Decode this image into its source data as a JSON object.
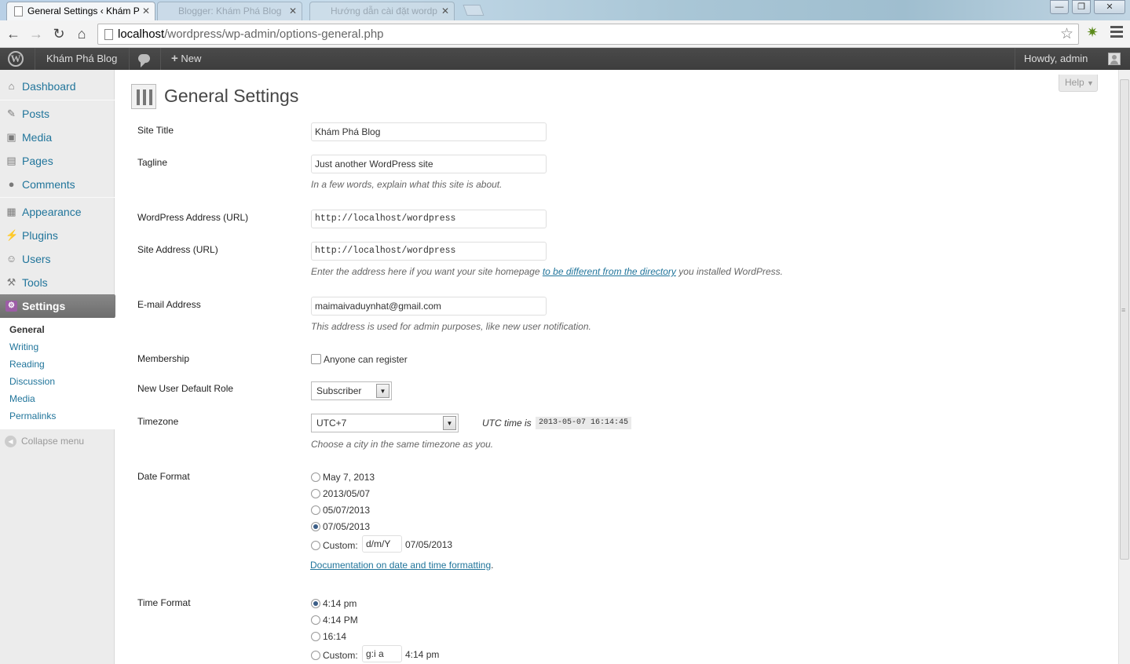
{
  "browser": {
    "active_tab_title": "General Settings ‹ Khám P",
    "tab2_title": "Blogger: Khám Phá Blog",
    "tab3_title": "Hướng dẫn cài đặt wordp",
    "url_host": "localhost",
    "url_path": "/wordpress/wp-admin/options-general.php"
  },
  "adminbar": {
    "site_name": "Khám Phá Blog",
    "new_label": "New",
    "howdy": "Howdy, admin"
  },
  "sidebar": {
    "items": [
      {
        "label": "Dashboard",
        "icon": "dashboard-icon"
      },
      {
        "label": "Posts",
        "icon": "pin-icon"
      },
      {
        "label": "Media",
        "icon": "media-icon"
      },
      {
        "label": "Pages",
        "icon": "pages-icon"
      },
      {
        "label": "Comments",
        "icon": "comment-icon"
      },
      {
        "label": "Appearance",
        "icon": "appearance-icon"
      },
      {
        "label": "Plugins",
        "icon": "plug-icon"
      },
      {
        "label": "Users",
        "icon": "users-icon"
      },
      {
        "label": "Tools",
        "icon": "tools-icon"
      },
      {
        "label": "Settings",
        "icon": "settings-icon"
      }
    ],
    "submenu": [
      "General",
      "Writing",
      "Reading",
      "Discussion",
      "Media",
      "Permalinks"
    ],
    "collapse_label": "Collapse menu"
  },
  "main": {
    "help_label": "Help",
    "page_title": "General Settings",
    "site_title_label": "Site Title",
    "site_title_value": "Khám Phá Blog",
    "tagline_label": "Tagline",
    "tagline_value": "Just another WordPress site",
    "tagline_desc": "In a few words, explain what this site is about.",
    "wp_address_label": "WordPress Address (URL)",
    "wp_address_value": "http://localhost/wordpress",
    "site_address_label": "Site Address (URL)",
    "site_address_value": "http://localhost/wordpress",
    "site_address_desc_pre": "Enter the address here if you want your site homepage ",
    "site_address_desc_link": "to be different from the directory",
    "site_address_desc_post": " you installed WordPress.",
    "email_label": "E-mail Address",
    "email_value": "maimaivaduynhat@gmail.com",
    "email_desc": "This address is used for admin purposes, like new user notification.",
    "membership_label": "Membership",
    "membership_checkbox": "Anyone can register",
    "role_label": "New User Default Role",
    "role_value": "Subscriber",
    "timezone_label": "Timezone",
    "timezone_value": "UTC+7",
    "utc_label": "UTC time is",
    "utc_value": "2013-05-07 16:14:45",
    "timezone_desc": "Choose a city in the same timezone as you.",
    "date_format_label": "Date Format",
    "date_options": [
      "May 7, 2013",
      "2013/05/07",
      "05/07/2013",
      "07/05/2013"
    ],
    "date_custom_label": "Custom:",
    "date_custom_value": "d/m/Y",
    "date_custom_preview": "07/05/2013",
    "doc_link": "Documentation on date and time formatting",
    "time_format_label": "Time Format",
    "time_options": [
      "4:14 pm",
      "4:14 PM",
      "16:14"
    ],
    "time_custom_label": "Custom:",
    "time_custom_value": "g:i a",
    "time_custom_preview": "4:14 pm"
  }
}
